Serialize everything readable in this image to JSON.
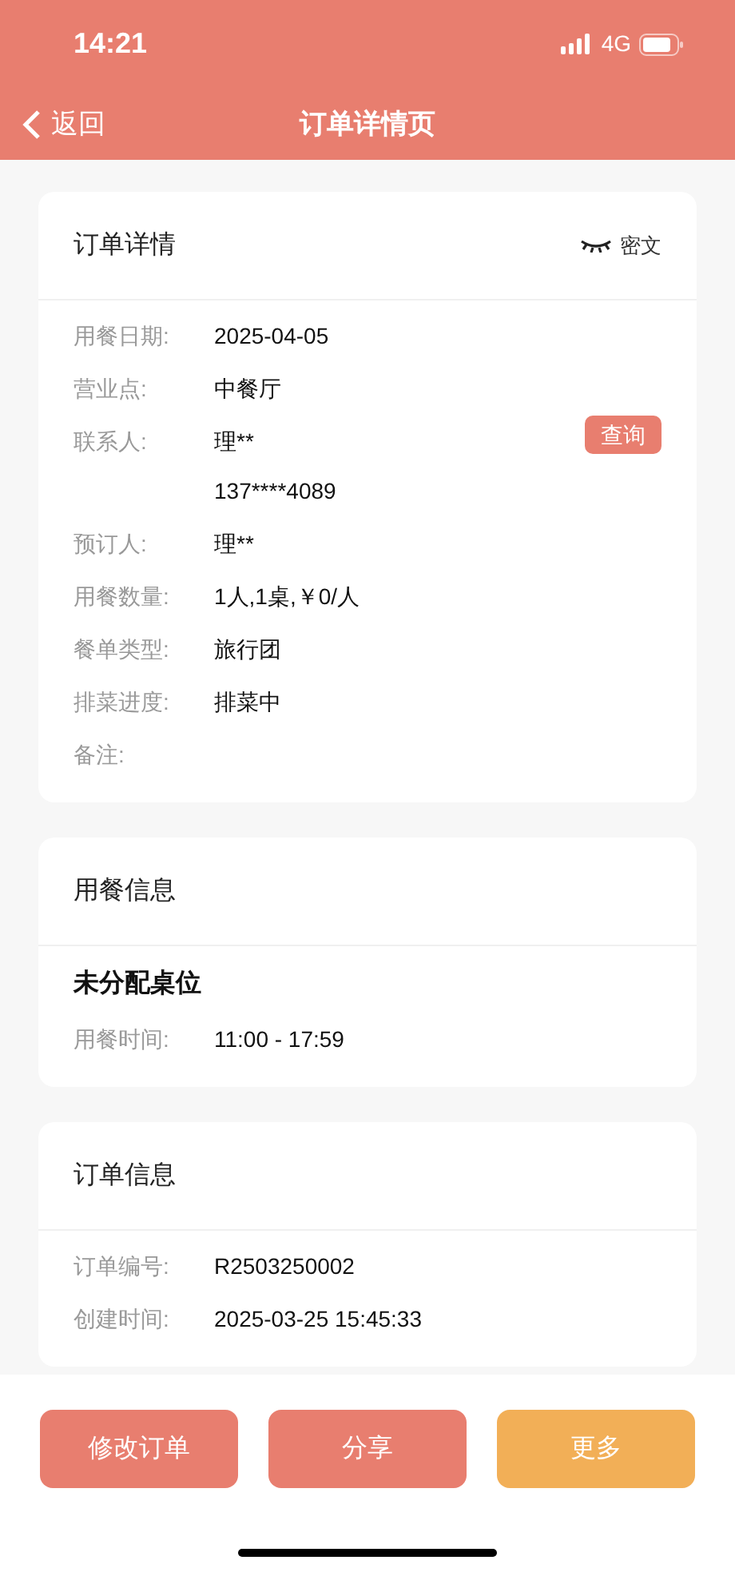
{
  "status_bar": {
    "time": "14:21",
    "network": "4G"
  },
  "nav": {
    "back": "返回",
    "title": "订单详情页"
  },
  "cards": [
    {
      "title": "订单详情",
      "toggle": {
        "label": "密文"
      },
      "rows": [
        {
          "label": "用餐日期:",
          "values": [
            "2025-04-05"
          ]
        },
        {
          "label": "营业点:",
          "values": [
            "中餐厅"
          ]
        },
        {
          "label": "联系人:",
          "values": [
            "理**",
            "137****4089"
          ],
          "action": "查询"
        },
        {
          "label": "预订人:",
          "values": [
            "理**"
          ]
        },
        {
          "label": "用餐数量:",
          "values": [
            "1人,1桌,￥0/人"
          ]
        },
        {
          "label": "餐单类型:",
          "values": [
            "旅行团"
          ]
        },
        {
          "label": "排菜进度:",
          "values": [
            "排菜中"
          ]
        },
        {
          "label": "备注:",
          "values": []
        }
      ]
    },
    {
      "title": "用餐信息",
      "heading": "未分配桌位",
      "rows": [
        {
          "label": "用餐时间:",
          "values": [
            "11:00 - 17:59"
          ]
        }
      ]
    },
    {
      "title": "订单信息",
      "rows": [
        {
          "label": "订单编号:",
          "values": [
            "R2503250002"
          ]
        },
        {
          "label": "创建时间:",
          "values": [
            "2025-03-25 15:45:33"
          ]
        }
      ]
    }
  ],
  "buttons": [
    {
      "label": "修改订单",
      "color": "#e87e6f"
    },
    {
      "label": "分享",
      "color": "#e87e6f"
    },
    {
      "label": "更多",
      "color": "#f2af57"
    }
  ]
}
